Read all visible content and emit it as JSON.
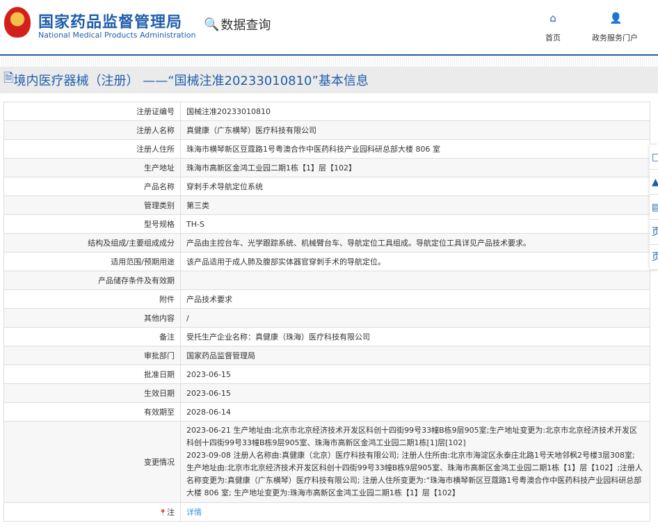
{
  "header": {
    "logo_cn": "国家药品监督管理局",
    "logo_en": "National Medical Products Administration",
    "data_query": "数据查询",
    "nav": [
      {
        "label": "首页",
        "icon": "home-icon"
      },
      {
        "label": "政务服务门户",
        "icon": "user-icon"
      }
    ]
  },
  "title": "境内医疗器械（注册） ——“国械注准20233010810”基本信息",
  "rows": [
    {
      "label": "注册证编号",
      "value": "国械注准20233010810"
    },
    {
      "label": "注册人名称",
      "value": "真健康（广东横琴）医疗科技有限公司"
    },
    {
      "label": "注册人住所",
      "value": "珠海市横琴新区豆蔻路1号粤澳合作中医药科技产业园科研总部大楼 806 室"
    },
    {
      "label": "生产地址",
      "value": "珠海市高新区金鸿工业园二期1栋【1】层【102】"
    },
    {
      "label": "产品名称",
      "value": "穿刺手术导航定位系统"
    },
    {
      "label": "管理类别",
      "value": "第三类"
    },
    {
      "label": "型号规格",
      "value": "TH-S"
    },
    {
      "label": "结构及组成/主要组成成分",
      "value": "产品由主控台车、光学跟踪系统、机械臂台车、导航定位工具组成。导航定位工具详见产品技术要求。"
    },
    {
      "label": "适用范围/预期用途",
      "value": "该产品适用于成人肺及腹部实体器官穿刺手术的导航定位。"
    },
    {
      "label": "产品储存条件及有效期",
      "value": ""
    },
    {
      "label": "附件",
      "value": "产品技术要求"
    },
    {
      "label": "其他内容",
      "value": "/"
    },
    {
      "label": "备注",
      "value": "受托生产企业名称：真健康（珠海）医疗科技有限公司"
    },
    {
      "label": "审批部门",
      "value": "国家药品监督管理局"
    },
    {
      "label": "批准日期",
      "value": "2023-06-15"
    },
    {
      "label": "生效日期",
      "value": "2023-06-15"
    },
    {
      "label": "有效期至",
      "value": "2028-06-14"
    }
  ],
  "changes": {
    "label": "变更情况",
    "lines": [
      "2023-06-21 生产地址由:北京市北京经济技术开发区科创十四街99号33幢B栋9层905室;生产地址变更为:北京市北京经济技术开发区科创十四街99号33幢B栋9层905室、珠海市高新区金鸿工业园二期1栋[1]层[102]",
      "2023-09-08 注册人名称由:真健康（北京）医疗科技有限公司; 注册人住所由:北京市海淀区永泰庄北路1号天地邻枫2号楼3层308室; 生产地址由:北京市北京经济技术开发区科创十四街99号33幢B栋9层905室、珠海市高新区金鸿工业园二期1栋【1】层【102】;注册人名称变更为:真健康（广东横琴）医疗科技有限公司; 注册人住所变更为:“珠海市横琴新区豆蔻路1号粤澳合作中医药科技产业园科研总部大楼 806 室; 生产地址变更为:珠海市高新区金鸿工业园二期1栋【1】层【102】"
    ]
  },
  "note": {
    "label": "注",
    "link": "详情"
  }
}
